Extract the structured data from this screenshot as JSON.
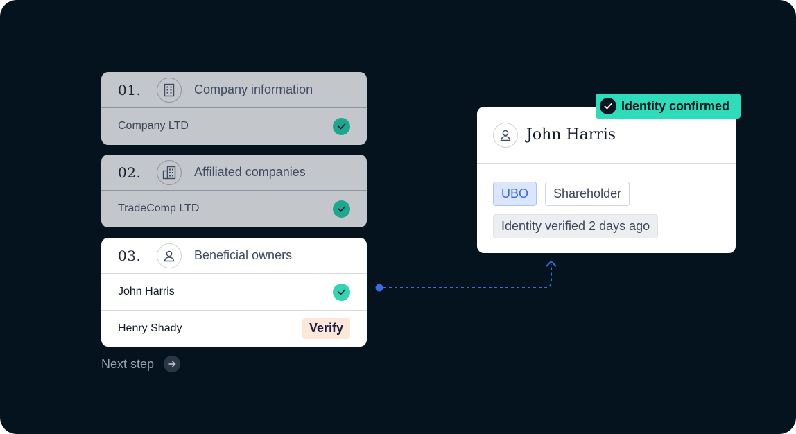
{
  "steps": [
    {
      "number": "01.",
      "title": "Company information",
      "icon": "building-icon",
      "rows": [
        {
          "label": "Company LTD",
          "status": "verified"
        }
      ]
    },
    {
      "number": "02.",
      "title": "Affiliated companies",
      "icon": "buildings-icon",
      "rows": [
        {
          "label": "TradeComp LTD",
          "status": "verified"
        }
      ]
    },
    {
      "number": "03.",
      "title": "Beneficial owners",
      "icon": "user-icon",
      "rows": [
        {
          "label": "John Harris",
          "status": "verified"
        },
        {
          "label": "Henry Shady",
          "action": "Verify"
        }
      ]
    }
  ],
  "next_step": {
    "label": "Next step",
    "icon": "arrow-right-icon"
  },
  "profile": {
    "badge": "Identity confirmed",
    "badge_icon": "check-circle-icon",
    "name": "John Harris",
    "avatar_icon": "user-icon",
    "tags": [
      "UBO",
      "Shareholder"
    ],
    "status": "Identity verified 2 days ago"
  },
  "colors": {
    "background": "#05131f",
    "completed_card": "#c3c6cb",
    "accent_teal": "#2fdcb9",
    "connector_blue": "#3b6ae6",
    "verify_button": "#fde7d8"
  }
}
